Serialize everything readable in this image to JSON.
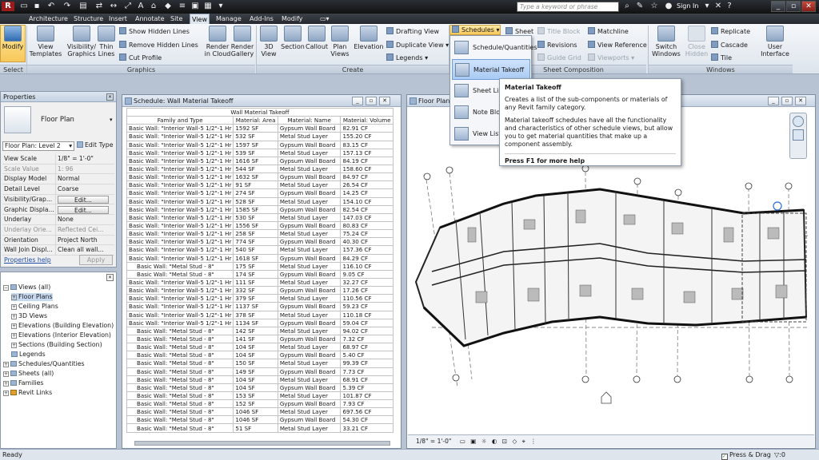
{
  "titlebar": {
    "search_placeholder": "Type a keyword or phrase",
    "sign_in": "Sign In"
  },
  "tabs": [
    "Architecture",
    "Structure",
    "Insert",
    "Annotate",
    "Site",
    "View",
    "Manage",
    "Add-Ins",
    "Modify"
  ],
  "ribbon": {
    "modify": "Modify",
    "select_group": "Select",
    "view_templates": "View\nTemplates",
    "visibility_graphics": "Visibility/\nGraphics",
    "thin_lines": "Thin\nLines",
    "show_hidden": "Show  Hidden Lines",
    "remove_hidden": "Remove  Hidden Lines",
    "cut_profile": "Cut  Profile",
    "render_cloud": "Render\nin Cloud",
    "render_gallery": "Render\nGallery",
    "graphics_group": "Graphics",
    "view3d": "3D\nView",
    "section": "Section",
    "callout": "Callout",
    "plan_views": "Plan\nViews",
    "elevation": "Elevation",
    "drafting_view": "Drafting  View",
    "duplicate_view": "Duplicate  View",
    "legends": "Legends",
    "create_group": "Create",
    "schedules": "Schedules",
    "sheet": "Sheet",
    "title_block": "Title  Block",
    "revisions": "Revisions",
    "guide_grid": "Guide  Grid",
    "matchline": "Matchline",
    "view_reference": "View  Reference",
    "viewports": "Viewports",
    "sheet_group": "Sheet Composition",
    "switch_windows": "Switch\nWindows",
    "close_hidden": "Close\nHidden",
    "replicate": "Replicate",
    "cascade": "Cascade",
    "tile": "Tile",
    "user_interface": "User\nInterface",
    "windows_group": "Windows"
  },
  "dropdown": {
    "items": [
      "Schedule/Quantities",
      "Material Takeoff",
      "Sheet List",
      "Note Block",
      "View List"
    ]
  },
  "tooltip": {
    "title": "Material Takeoff",
    "p1": "Creates a list of the sub-components or materials of any Revit family category.",
    "p2": "Material takeoff schedules have all the functionality and characteristics of other schedule views, but allow you to get material quantities that make up a component assembly.",
    "help": "Press F1 for more help"
  },
  "properties": {
    "title": "Properties",
    "type_name": "Floor Plan",
    "instance": "Floor Plan: Level 2",
    "edit_type": "Edit Type",
    "rows": [
      {
        "k": "View Scale",
        "v": "1/8\" = 1'-0\""
      },
      {
        "k": "Scale Value",
        "v": "1:  96",
        "dim": true
      },
      {
        "k": "Display Model",
        "v": "Normal"
      },
      {
        "k": "Detail Level",
        "v": "Coarse"
      },
      {
        "k": "Visibility/Grap...",
        "v": "Edit...",
        "btn": true
      },
      {
        "k": "Graphic Displa...",
        "v": "Edit...",
        "btn": true
      },
      {
        "k": "Underlay",
        "v": "None"
      },
      {
        "k": "Underlay Orie...",
        "v": "Reflected Cei...",
        "dim": true
      },
      {
        "k": "Orientation",
        "v": "Project North"
      },
      {
        "k": "Wall Join Displ...",
        "v": "Clean all wall..."
      }
    ],
    "help": "Properties help",
    "apply": "Apply"
  },
  "browser": {
    "items": [
      "Views (all)",
      "Floor Plans",
      "Ceiling Plans",
      "3D Views",
      "Elevations (Building Elevation)",
      "Elevations (Interior Elevation)",
      "Sections (Building Section)",
      "Legends",
      "Schedules/Quantities",
      "Sheets (all)",
      "Families",
      "Revit Links"
    ]
  },
  "schedule": {
    "window_title": "Schedule: Wall Material Takeoff",
    "table_title": "Wall Material Takeoff",
    "headers": [
      "Family and Type",
      "Material: Area",
      "Material: Name",
      "Material: Volume"
    ],
    "rows": [
      [
        "Basic Wall: \"Interior Wall-5 1/2\"-1 Hr",
        "1592 SF",
        "Gypsum Wall Board",
        "82.91 CF"
      ],
      [
        "Basic Wall: \"Interior Wall-5 1/2\"-1 Hr",
        "532 SF",
        "Metal Stud Layer",
        "155.20 CF"
      ],
      [
        "Basic Wall: \"Interior Wall-5 1/2\"-1 Hr",
        "1597 SF",
        "Gypsum Wall Board",
        "83.15 CF"
      ],
      [
        "Basic Wall: \"Interior Wall-5 1/2\"-1 Hr",
        "539 SF",
        "Metal Stud Layer",
        "157.13 CF"
      ],
      [
        "Basic Wall: \"Interior Wall-5 1/2\"-1 Hr",
        "1616 SF",
        "Gypsum Wall Board",
        "84.19 CF"
      ],
      [
        "Basic Wall: \"Interior Wall-5 1/2\"-1 Hr",
        "544 SF",
        "Metal Stud Layer",
        "158.60 CF"
      ],
      [
        "Basic Wall: \"Interior Wall-5 1/2\"-1 Hr",
        "1632 SF",
        "Gypsum Wall Board",
        "84.97 CF"
      ],
      [
        "Basic Wall: \"Interior Wall-5 1/2\"-1 Hr",
        "91 SF",
        "Metal Stud Layer",
        "26.54 CF"
      ],
      [
        "Basic Wall: \"Interior Wall-5 1/2\"-1 Hr",
        "274 SF",
        "Gypsum Wall Board",
        "14.25 CF"
      ],
      [
        "Basic Wall: \"Interior Wall-5 1/2\"-1 Hr",
        "528 SF",
        "Metal Stud Layer",
        "154.10 CF"
      ],
      [
        "Basic Wall: \"Interior Wall-5 1/2\"-1 Hr",
        "1585 SF",
        "Gypsum Wall Board",
        "82.54 CF"
      ],
      [
        "Basic Wall: \"Interior Wall-5 1/2\"-1 Hr",
        "530 SF",
        "Metal Stud Layer",
        "147.03 CF"
      ],
      [
        "Basic Wall: \"Interior Wall-5 1/2\"-1 Hr",
        "1556 SF",
        "Gypsum Wall Board",
        "80.83 CF"
      ],
      [
        "Basic Wall: \"Interior Wall-5 1/2\"-1 Hr",
        "258 SF",
        "Metal Stud Layer",
        "75.24 CF"
      ],
      [
        "Basic Wall: \"Interior Wall-5 1/2\"-1 Hr",
        "774 SF",
        "Gypsum Wall Board",
        "40.30 CF"
      ],
      [
        "Basic Wall: \"Interior Wall-5 1/2\"-1 Hr",
        "540 SF",
        "Metal Stud Layer",
        "157.36 CF"
      ],
      [
        "Basic Wall: \"Interior Wall-5 1/2\"-1 Hr",
        "1618 SF",
        "Gypsum Wall Board",
        "84.29 CF"
      ],
      [
        "Basic Wall: \"Metal Stud - 8\"",
        "175 SF",
        "Metal Stud Layer",
        "116.10 CF"
      ],
      [
        "Basic Wall: \"Metal Stud - 8\"",
        "174 SF",
        "Gypsum Wall Board",
        "9.05 CF"
      ],
      [
        "Basic Wall: \"Interior Wall-5 1/2\"-1 Hr",
        "111 SF",
        "Metal Stud Layer",
        "32.27 CF"
      ],
      [
        "Basic Wall: \"Interior Wall-5 1/2\"-1 Hr",
        "332 SF",
        "Gypsum Wall Board",
        "17.26 CF"
      ],
      [
        "Basic Wall: \"Interior Wall-5 1/2\"-1 Hr",
        "379 SF",
        "Metal Stud Layer",
        "110.56 CF"
      ],
      [
        "Basic Wall: \"Interior Wall-5 1/2\"-1 Hr",
        "1137 SF",
        "Gypsum Wall Board",
        "59.23 CF"
      ],
      [
        "Basic Wall: \"Interior Wall-5 1/2\"-1 Hr",
        "378 SF",
        "Metal Stud Layer",
        "110.18 CF"
      ],
      [
        "Basic Wall: \"Interior Wall-5 1/2\"-1 Hr",
        "1134 SF",
        "Gypsum Wall Board",
        "59.04 CF"
      ],
      [
        "Basic Wall: \"Metal Stud - 8\"",
        "142 SF",
        "Metal Stud Layer",
        "94.02 CF"
      ],
      [
        "Basic Wall: \"Metal Stud - 8\"",
        "141 SF",
        "Gypsum Wall Board",
        "7.32 CF"
      ],
      [
        "Basic Wall: \"Metal Stud - 8\"",
        "104 SF",
        "Metal Stud Layer",
        "68.97 CF"
      ],
      [
        "Basic Wall: \"Metal Stud - 8\"",
        "104 SF",
        "Gypsum Wall Board",
        "5.40 CF"
      ],
      [
        "Basic Wall: \"Metal Stud - 8\"",
        "150 SF",
        "Metal Stud Layer",
        "99.39 CF"
      ],
      [
        "Basic Wall: \"Metal Stud - 8\"",
        "149 SF",
        "Gypsum Wall Board",
        "7.73 CF"
      ],
      [
        "Basic Wall: \"Metal Stud - 8\"",
        "104 SF",
        "Metal Stud Layer",
        "68.91 CF"
      ],
      [
        "Basic Wall: \"Metal Stud - 8\"",
        "104 SF",
        "Gypsum Wall Board",
        "5.39 CF"
      ],
      [
        "Basic Wall: \"Metal Stud - 8\"",
        "153 SF",
        "Metal Stud Layer",
        "101.87 CF"
      ],
      [
        "Basic Wall: \"Metal Stud - 8\"",
        "152 SF",
        "Gypsum Wall Board",
        "7.93 CF"
      ],
      [
        "Basic Wall: \"Metal Stud - 8\"",
        "1046 SF",
        "Metal Stud Layer",
        "697.56 CF"
      ],
      [
        "Basic Wall: \"Metal Stud - 8\"",
        "1046 SF",
        "Gypsum Wall Board",
        "54.30 CF"
      ],
      [
        "Basic Wall: \"Metal Stud - 8\"",
        "51 SF",
        "Metal Stud Layer",
        "33.21 CF"
      ]
    ]
  },
  "floorplan": {
    "window_title": "Floor Plan: Level 2",
    "scale": "1/8\" = 1'-0\"",
    "grid_labels": [
      "4",
      "3",
      "2",
      "5",
      "6",
      "7"
    ]
  },
  "status": {
    "ready": "Ready",
    "press_drag": "Press & Drag",
    "filter_count": ":0"
  }
}
